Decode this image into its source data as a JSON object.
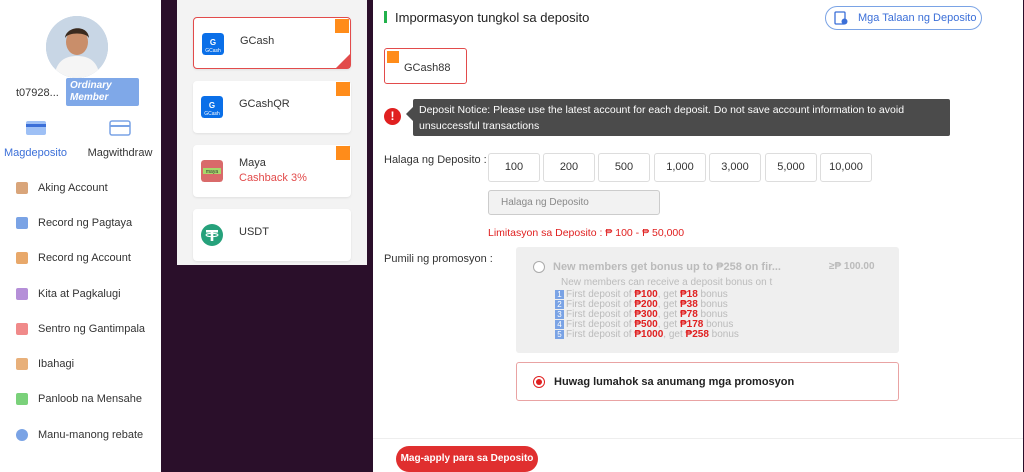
{
  "profile": {
    "username": "t07928...",
    "member_badge": "Ordinary Member"
  },
  "tabs": {
    "deposit": "Magdeposito",
    "withdraw": "Magwithdraw"
  },
  "menu": [
    {
      "label": "Aking Account",
      "icon": "wallet-icon",
      "color": "#d9a57a"
    },
    {
      "label": "Record ng Pagtaya",
      "icon": "bet-record-icon",
      "color": "#7aa3e5"
    },
    {
      "label": "Record ng Account",
      "icon": "account-record-icon",
      "color": "#e8a86a"
    },
    {
      "label": "Kita at Pagkalugi",
      "icon": "profit-loss-icon",
      "color": "#b58fd8"
    },
    {
      "label": "Sentro ng Gantimpala",
      "icon": "reward-icon",
      "color": "#f08a8a"
    },
    {
      "label": "Ibahagi",
      "icon": "share-icon",
      "color": "#e8b07a"
    },
    {
      "label": "Panloob na Mensahe",
      "icon": "message-icon",
      "color": "#7ad17a"
    },
    {
      "label": "Manu-manong rebate",
      "icon": "rebate-icon",
      "color": "#7aa3e5"
    }
  ],
  "methods": [
    {
      "name": "GCash",
      "sub": "",
      "logo": "gcash-logo",
      "color": "#0a6fe8",
      "selected": true
    },
    {
      "name": "GCashQR",
      "sub": "",
      "logo": "gcash-logo",
      "color": "#0a6fe8",
      "selected": false
    },
    {
      "name": "Maya",
      "sub": "Cashback 3%",
      "logo": "maya-logo",
      "color": "#d96a6a",
      "selected": false
    },
    {
      "name": "USDT",
      "sub": "",
      "logo": "tether-logo",
      "color": "#26a17b",
      "selected": false
    }
  ],
  "main": {
    "title": "Impormasyon tungkol sa deposito",
    "records_button": "Mga Talaan ng Deposito",
    "channel": "GCash88",
    "notice": "Deposit Notice: Please use the latest account for each deposit. Do not save account information to avoid unsuccessful transactions",
    "amount_label": "Halaga ng Deposito :",
    "amounts": [
      "100",
      "200",
      "500",
      "1,000",
      "3,000",
      "5,000",
      "10,000"
    ],
    "amount_placeholder": "Halaga ng Deposito",
    "limit": "Limitasyon sa Deposito : ₱ 100 - ₱ 50,000",
    "promo_label": "Pumili ng promosyon :",
    "promo": {
      "title": "New members get bonus up to ₱258 on fir...",
      "min": "≥₱ 100.00",
      "desc": "New members can receive a deposit bonus on t",
      "lines": [
        {
          "n": "1",
          "pre": "First deposit of ",
          "amt": "₱100",
          "mid": ", get ",
          "bonus": "₱18",
          "post": " bonus"
        },
        {
          "n": "2",
          "pre": "First deposit of ",
          "amt": "₱200",
          "mid": ", get ",
          "bonus": "₱38",
          "post": " bonus"
        },
        {
          "n": "3",
          "pre": "First deposit of ",
          "amt": "₱300",
          "mid": ", get ",
          "bonus": "₱78",
          "post": " bonus"
        },
        {
          "n": "4",
          "pre": "First deposit of ",
          "amt": "₱500",
          "mid": ", get ",
          "bonus": "₱178",
          "post": " bonus"
        },
        {
          "n": "5",
          "pre": "First deposit of ",
          "amt": "₱1000",
          "mid": ", get ",
          "bonus": "₱258",
          "post": " bonus"
        }
      ]
    },
    "no_promo": "Huwag lumahok sa anumang mga promosyon",
    "apply_button": "Mag-apply para sa Deposito"
  }
}
